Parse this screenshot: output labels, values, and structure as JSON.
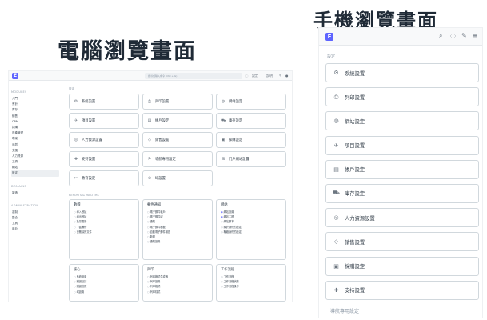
{
  "headings": {
    "desktop": "電腦瀏覽畫面",
    "mobile": "手機瀏覽畫面"
  },
  "app": {
    "logo_letter": "E",
    "search_placeholder": "搜尋或輸入命令 (Ctrl + G)",
    "settings_menu": "設定",
    "help_menu": "說明"
  },
  "sidebar": {
    "modules_header": "MODULES",
    "modules": [
      "入門",
      "會計",
      "庫存",
      "銷售",
      "CRM",
      "採購",
      "資產管理",
      "專案",
      "品質",
      "支援",
      "人力資源",
      "工資",
      "網站",
      "設定"
    ],
    "active_index": 13,
    "domains_header": "DOMAINS",
    "domains": [
      "製造"
    ],
    "admin_header": "ADMINISTRATION",
    "admin": [
      "定制",
      "整合",
      "工具",
      "用戶"
    ]
  },
  "main": {
    "section_label": "設定",
    "cards": [
      {
        "icon": "system-icon",
        "glyph": "⚙",
        "label": "系統設置"
      },
      {
        "icon": "print-icon",
        "glyph": "⎙",
        "label": "列印設置"
      },
      {
        "icon": "globe-icon",
        "glyph": "◍",
        "label": "網站設定"
      },
      {
        "icon": "rocket-icon",
        "glyph": "✈",
        "label": "項目設置"
      },
      {
        "icon": "book-icon",
        "glyph": "▤",
        "label": "帳戶設定"
      },
      {
        "icon": "truck-icon",
        "glyph": "⛟",
        "label": "庫存設定"
      },
      {
        "icon": "hr-icon",
        "glyph": "◎",
        "label": "人力資源設置"
      },
      {
        "icon": "tag-icon",
        "glyph": "◇",
        "label": "銷售設置"
      },
      {
        "icon": "purchase-icon",
        "glyph": "▣",
        "label": "採購設定"
      },
      {
        "icon": "support-icon",
        "glyph": "✚",
        "label": "支持設置"
      },
      {
        "icon": "fleet-icon",
        "glyph": "⚑",
        "label": "導航專用設定"
      },
      {
        "icon": "portal-icon",
        "glyph": "⊞",
        "label": "門戶網站設置"
      },
      {
        "icon": "tools-icon",
        "glyph": "✂",
        "label": "教育設定"
      },
      {
        "icon": "domain-icon",
        "glyph": "⊕",
        "label": "域設置"
      }
    ],
    "reports_label": "REPORTS & MASTERS",
    "modules": [
      {
        "title": "數據",
        "links": [
          "導入數據",
          "導出數據",
          "批量更新",
          "下載備份",
          "已刪除的文件"
        ],
        "active": []
      },
      {
        "title": "郵件通知",
        "links": [
          "電子郵件帳戶",
          "電子郵件域",
          "通知",
          "電子郵件模板",
          "自動電子郵件報告",
          "新聞",
          "通知設置"
        ],
        "active": []
      },
      {
        "title": "網站",
        "links": [
          "網站設置",
          "網站主題",
          "網站腳本",
          "關於我們的設定",
          "聯絡我們的設定"
        ],
        "active": [
          0,
          1
        ]
      },
      {
        "title": "核心",
        "links": [
          "系統設置",
          "錯誤日誌",
          "錯誤快照",
          "域設置"
        ],
        "active": []
      },
      {
        "title": "列印",
        "links": [
          "列印格式生成器",
          "列印設置",
          "列印格式",
          "列印樣式"
        ],
        "active": []
      },
      {
        "title": "工作流程",
        "links": [
          "工作流程",
          "工作流程狀態",
          "工作流程操作"
        ],
        "active": []
      }
    ]
  },
  "mobile": {
    "section_label": "設定",
    "cards": [
      {
        "icon": "system-icon",
        "glyph": "⚙",
        "label": "系統設置"
      },
      {
        "icon": "print-icon",
        "glyph": "⎙",
        "label": "列印設置"
      },
      {
        "icon": "globe-icon",
        "glyph": "◍",
        "label": "網站設定"
      },
      {
        "icon": "rocket-icon",
        "glyph": "✈",
        "label": "項目設置"
      },
      {
        "icon": "book-icon",
        "glyph": "▤",
        "label": "帳戶設定"
      },
      {
        "icon": "truck-icon",
        "glyph": "⛟",
        "label": "庫存設定"
      },
      {
        "icon": "hr-icon",
        "glyph": "◎",
        "label": "人力資源設置"
      },
      {
        "icon": "tag-icon",
        "glyph": "◇",
        "label": "銷售設置"
      },
      {
        "icon": "purchase-icon",
        "glyph": "▣",
        "label": "採購設定"
      },
      {
        "icon": "support-icon",
        "glyph": "✚",
        "label": "支持設置"
      }
    ],
    "partial_label": "導航專用設定"
  }
}
